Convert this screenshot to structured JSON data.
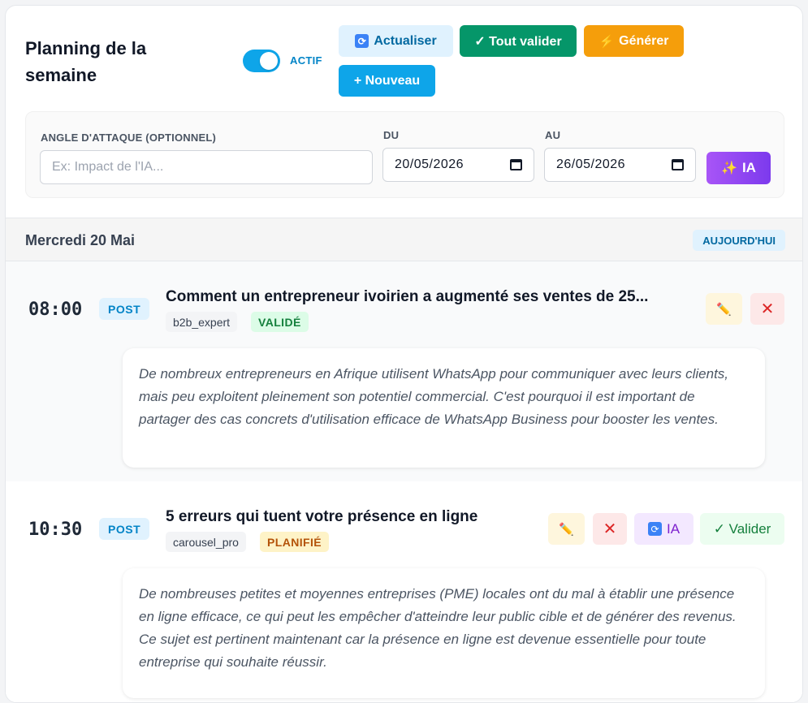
{
  "header": {
    "title": "Planning de la semaine",
    "toggle_label": "ACTIF",
    "toggle_on": true,
    "buttons": {
      "refresh": "Actualiser",
      "validate_all": "✓ Tout valider",
      "generate": "Générer",
      "new": "+ Nouveau"
    }
  },
  "filters": {
    "angle_label": "ANGLE D'ATTAQUE (OPTIONNEL)",
    "angle_placeholder": "Ex: Impact de l'IA...",
    "angle_value": "",
    "from_label": "DU",
    "from_value": "20/05/2026",
    "to_label": "AU",
    "to_value": "26/05/2026",
    "ia_button": "IA"
  },
  "day": {
    "title": "Mercredi 20 Mai",
    "badge": "AUJOURD'HUI"
  },
  "posts": [
    {
      "time": "08:00",
      "type": "POST",
      "title": "Comment un entrepreneur ivoirien a augmenté ses ventes de 25...",
      "author": "b2b_expert",
      "status": "VALIDÉ",
      "excerpt": "De nombreux entrepreneurs en Afrique utilisent WhatsApp pour communiquer avec leurs clients, mais peu exploitent pleinement son potentiel commercial. C'est pourquoi il est important de partager des cas concrets d'utilisation efficace de WhatsApp Business pour booster les ventes."
    },
    {
      "time": "10:30",
      "type": "POST",
      "title": "5 erreurs qui tuent votre présence en ligne",
      "author": "carousel_pro",
      "status": "PLANIFIÉ",
      "actions": {
        "ia": "IA",
        "validate": "✓ Valider"
      },
      "excerpt": "De nombreuses petites et moyennes entreprises (PME) locales ont du mal à établir une présence en ligne efficace, ce qui peut les empêcher d'atteindre leur public cible et de générer des revenus. Ce sujet est pertinent maintenant car la présence en ligne est devenue essentielle pour toute entreprise qui souhaite réussir."
    }
  ]
}
